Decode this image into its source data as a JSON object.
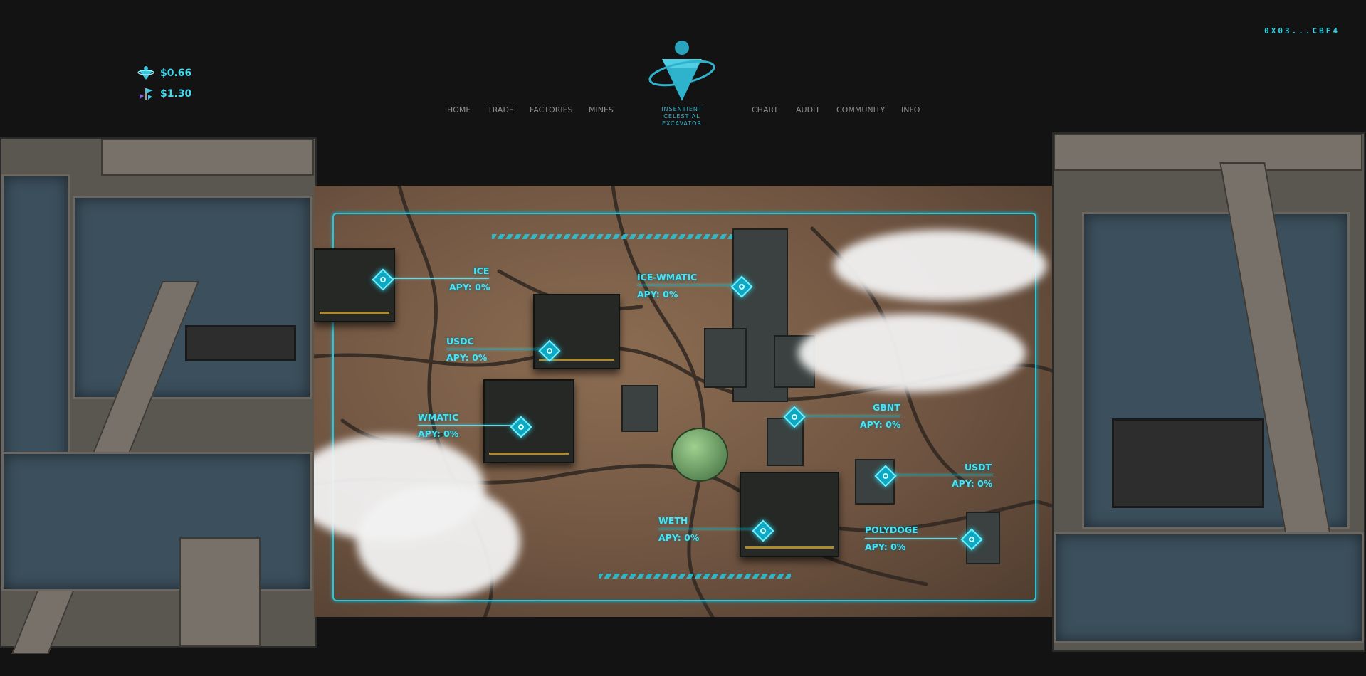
{
  "wallet": {
    "address": "0X03...CBF4"
  },
  "prices": [
    {
      "icon": "ice-token-icon",
      "value": "$0.66"
    },
    {
      "icon": "matic-flag-icon",
      "value": "$1.30"
    }
  ],
  "brand": {
    "line1": "INSENTIENT CELESTIAL",
    "line2": "EXCAVATOR",
    "logo_icon": "ice-logo-icon"
  },
  "nav": {
    "left": [
      "HOME",
      "TRADE",
      "FACTORIES",
      "MINES"
    ],
    "right": [
      "CHART",
      "AUDIT",
      "COMMUNITY",
      "INFO"
    ]
  },
  "pools": [
    {
      "name": "ICE",
      "apy": "APY: 0%"
    },
    {
      "name": "ICE-WMATIC",
      "apy": "APY: 0%"
    },
    {
      "name": "USDC",
      "apy": "APY: 0%"
    },
    {
      "name": "WMATIC",
      "apy": "APY: 0%"
    },
    {
      "name": "GBNT",
      "apy": "APY: 0%"
    },
    {
      "name": "USDT",
      "apy": "APY: 0%"
    },
    {
      "name": "WETH",
      "apy": "APY: 0%"
    },
    {
      "name": "POLYDOGE",
      "apy": "APY: 0%"
    }
  ],
  "colors": {
    "accent": "#2fd6e8",
    "nav_text": "#8e8e8e",
    "background": "#131313"
  }
}
